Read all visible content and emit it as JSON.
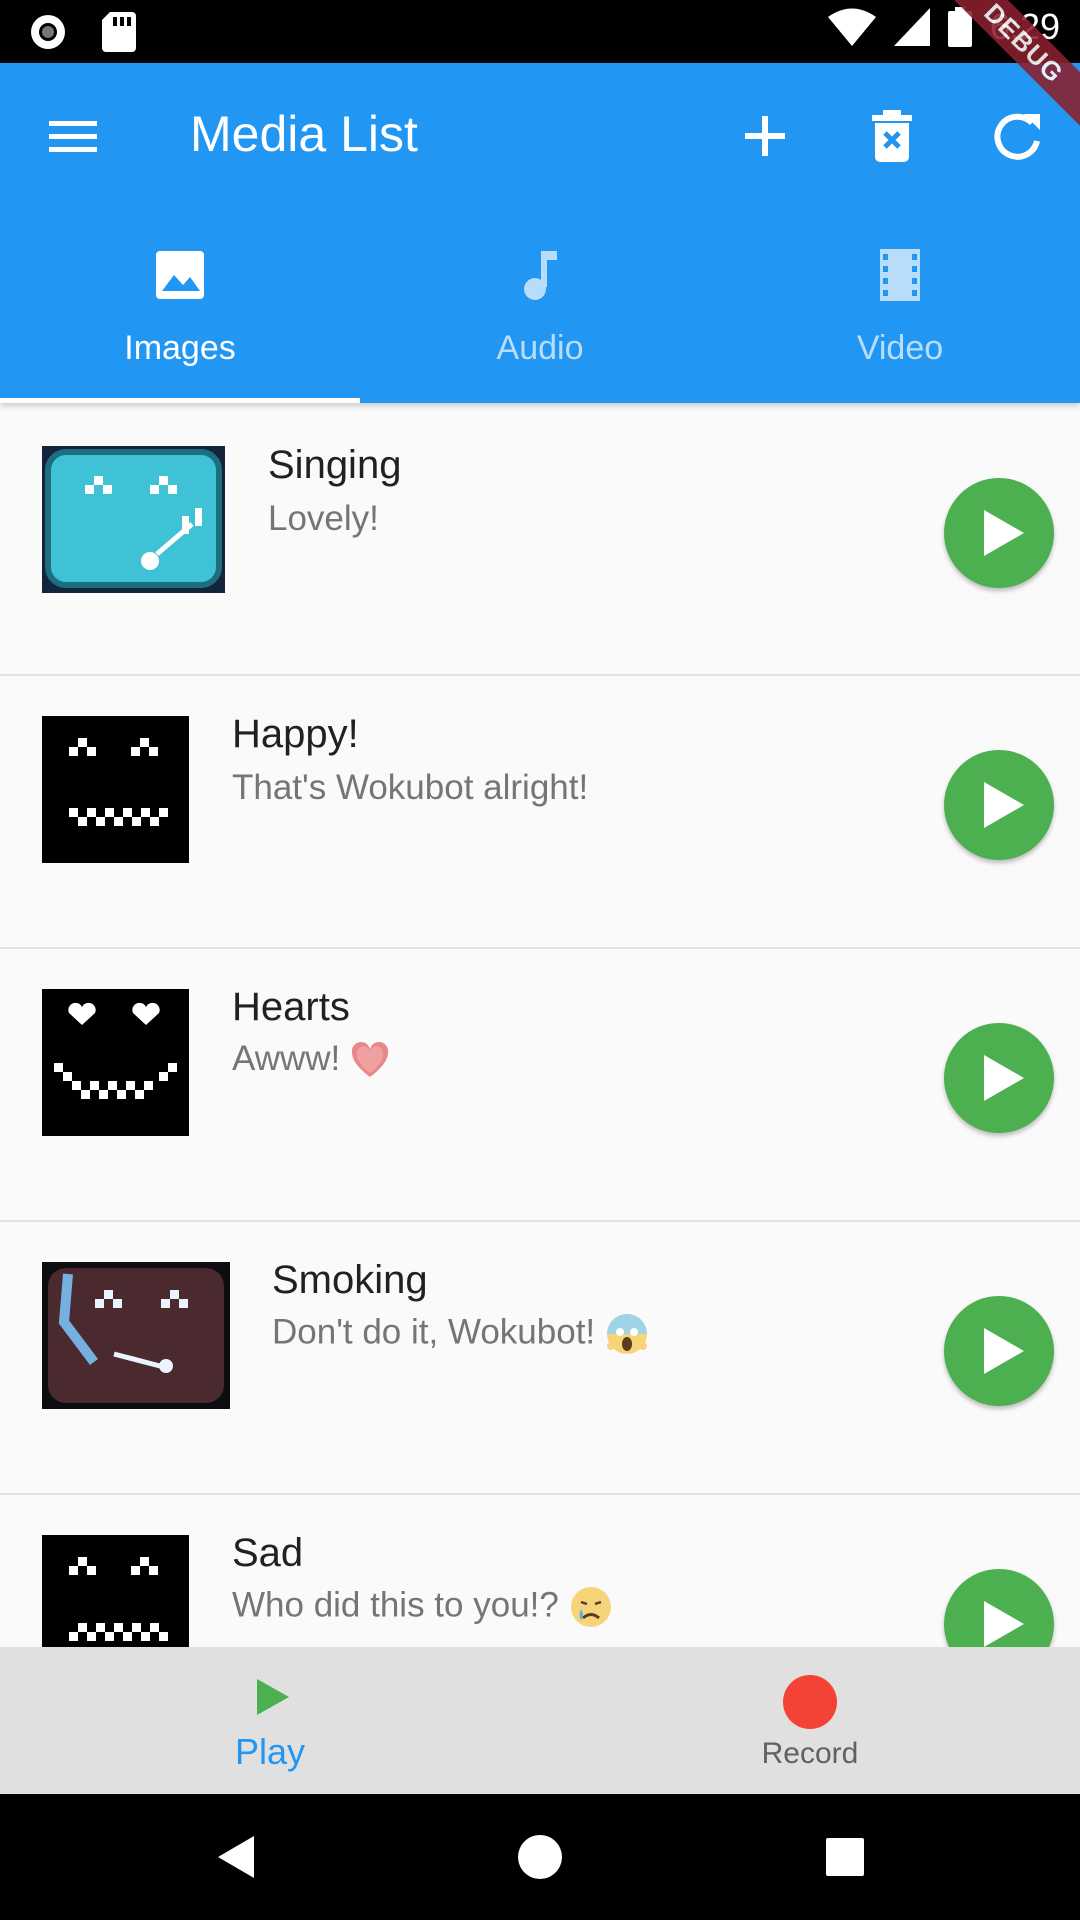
{
  "status_bar": {
    "time": "6:29",
    "icons": [
      "record-indicator-icon",
      "sd-card-icon",
      "wifi-icon",
      "cell-signal-icon",
      "battery-icon"
    ]
  },
  "debug_banner": "DEBUG",
  "app_bar": {
    "title": "Media List",
    "actions": [
      "add-icon",
      "delete-icon",
      "refresh-icon"
    ]
  },
  "tabs": [
    {
      "label": "Images",
      "icon": "image-icon",
      "selected": true
    },
    {
      "label": "Audio",
      "icon": "music-note-icon",
      "selected": false
    },
    {
      "label": "Video",
      "icon": "film-icon",
      "selected": false
    }
  ],
  "items": [
    {
      "title": "Singing",
      "subtitle": "Lovely!",
      "emoji": ""
    },
    {
      "title": "Happy!",
      "subtitle": "That's Wokubot alright!",
      "emoji": ""
    },
    {
      "title": "Hearts",
      "subtitle": "Awww!",
      "emoji": "heart"
    },
    {
      "title": "Smoking",
      "subtitle": "Don't do it, Wokubot!",
      "emoji": "scream"
    },
    {
      "title": "Sad",
      "subtitle": "Who did this to you!?",
      "emoji": "tear"
    }
  ],
  "bottom_nav": {
    "play_label": "Play",
    "record_label": "Record"
  },
  "colors": {
    "primary": "#2196f3",
    "play_green": "#4caf50",
    "record_red": "#f44336"
  }
}
